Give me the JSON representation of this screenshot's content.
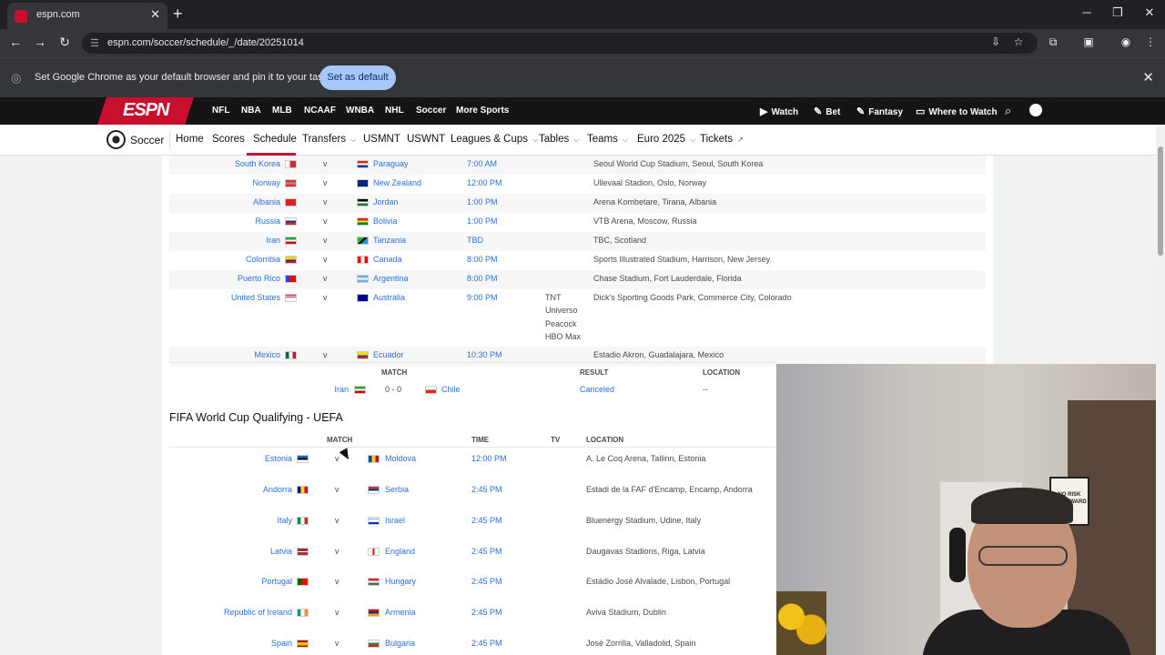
{
  "browser": {
    "tab_title": "espn.com",
    "tab_close": "✕",
    "new_tab": "+",
    "window_min": "─",
    "window_max": "❐",
    "window_close": "✕",
    "url": "espn.com/soccer/schedule/_/date/20251014",
    "infobar_text": "Set Google Chrome as your default browser and pin it to your taskbar",
    "infobar_button": "Set as default",
    "infobar_close": "✕"
  },
  "espn_nav": {
    "logo": "ESPN",
    "links": [
      "NFL",
      "NBA",
      "MLB",
      "NCAAF",
      "WNBA",
      "NHL",
      "Soccer",
      "More Sports"
    ],
    "right": [
      "Watch",
      "Bet",
      "Fantasy",
      "Where to Watch"
    ]
  },
  "soccer_nav": {
    "title": "Soccer",
    "links": [
      "Home",
      "Scores",
      "Schedule",
      "Transfers",
      "USMNT",
      "USWNT",
      "Leagues & Cups",
      "Tables",
      "Teams",
      "Euro 2025",
      "Tickets"
    ]
  },
  "friendlies": [
    {
      "home": "South Korea",
      "away": "Paraguay",
      "time": "7:00 AM",
      "tv": "",
      "location": "Seoul World Cup Stadium, Seoul, South Korea"
    },
    {
      "home": "Norway",
      "away": "New Zealand",
      "time": "12:00 PM",
      "tv": "",
      "location": "Ullevaal Stadion, Oslo, Norway"
    },
    {
      "home": "Albania",
      "away": "Jordan",
      "time": "1:00 PM",
      "tv": "",
      "location": "Arena Kombetare, Tirana, Albania"
    },
    {
      "home": "Russia",
      "away": "Bolivia",
      "time": "1:00 PM",
      "tv": "",
      "location": "VTB Arena, Moscow, Russia"
    },
    {
      "home": "Iran",
      "away": "Tanzania",
      "time": "TBD",
      "tv": "",
      "location": "TBC, Scotland"
    },
    {
      "home": "Colombia",
      "away": "Canada",
      "time": "8:00 PM",
      "tv": "",
      "location": "Sports Illustrated Stadium, Harrison, New Jersey"
    },
    {
      "home": "Puerto Rico",
      "away": "Argentina",
      "time": "8:00 PM",
      "tv": "",
      "location": "Chase Stadium, Fort Lauderdale, Florida"
    },
    {
      "home": "United States",
      "away": "Australia",
      "time": "9:00 PM",
      "tv": "TNT\nUniverso\nPeacock\nHBO Max",
      "location": "Dick's Sporting Goods Park, Commerce City, Colorado"
    },
    {
      "home": "Mexico",
      "away": "Ecuador",
      "time": "10:30 PM",
      "tv": "",
      "location": "Estadio Akron, Guadalajara, Mexico"
    }
  ],
  "result_table": {
    "headers": {
      "match": "MATCH",
      "result": "RESULT",
      "location": "LOCATION"
    },
    "row": {
      "home": "Iran",
      "score": "0 - 0",
      "away": "Chile",
      "result": "Canceled",
      "location": "--"
    }
  },
  "uefa_section": {
    "title": "FIFA World Cup Qualifying - UEFA",
    "headers": {
      "match": "MATCH",
      "time": "TIME",
      "tv": "TV",
      "location": "LOCATION"
    },
    "matches": [
      {
        "home": "Estonia",
        "away": "Moldova",
        "time": "12:00 PM",
        "location": "A. Le Coq Arena, Tallinn, Estonia"
      },
      {
        "home": "Andorra",
        "away": "Serbia",
        "time": "2:45 PM",
        "location": "Estadi de la FAF d'Encamp, Encamp, Andorra"
      },
      {
        "home": "Italy",
        "away": "Israel",
        "time": "2:45 PM",
        "location": "Bluenergy Stadium, Udine, Italy"
      },
      {
        "home": "Latvia",
        "away": "England",
        "time": "2:45 PM",
        "location": "Daugavas Stadions, Riga, Latvia"
      },
      {
        "home": "Portugal",
        "away": "Hungary",
        "time": "2:45 PM",
        "location": "Estádio José Alvalade, Lisbon, Portugal"
      },
      {
        "home": "Republic of Ireland",
        "away": "Armenia",
        "time": "2:45 PM",
        "location": "Aviva Stadium, Dublin"
      },
      {
        "home": "Spain",
        "away": "Bulgaria",
        "time": "2:45 PM",
        "location": "José Zorrilla, Valladolid, Spain"
      }
    ]
  },
  "vs_label": "v",
  "webcam_poster": "NO RISK\nNO REWARD"
}
